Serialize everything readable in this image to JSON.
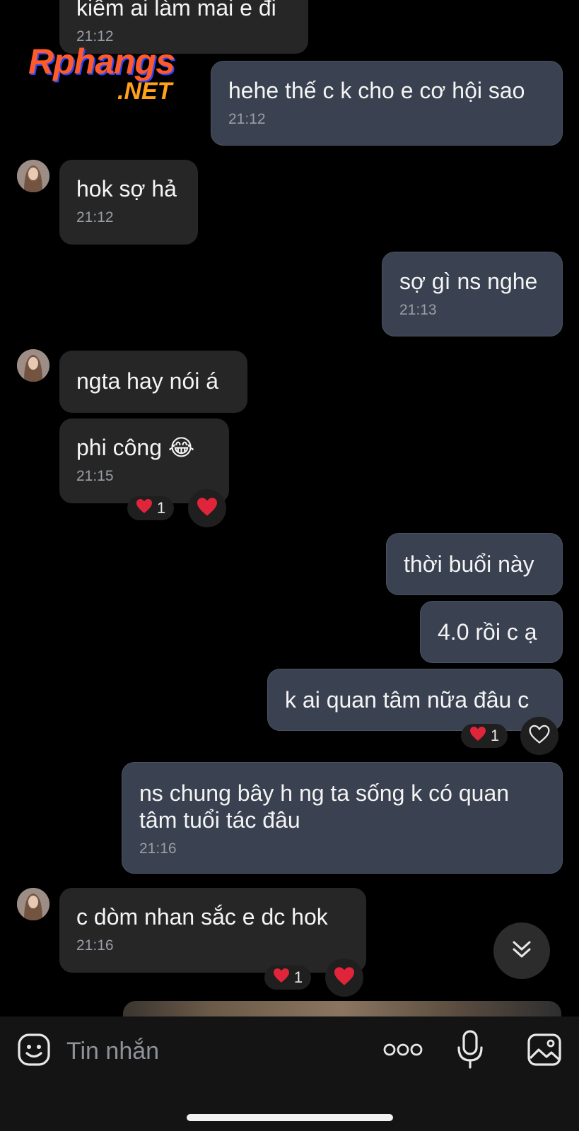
{
  "watermark": {
    "brand": "Rphangs",
    "tld": ".NET"
  },
  "messages": [
    {
      "id": "m0",
      "from": "them",
      "text": "kiếm ai làm mai e đi",
      "time": "21:12"
    },
    {
      "id": "m1",
      "from": "me",
      "text": "hehe thế c k cho e cơ hội sao",
      "time": "21:12"
    },
    {
      "id": "m2",
      "from": "them",
      "text": "hok sợ hả",
      "time": "21:12"
    },
    {
      "id": "m3",
      "from": "me",
      "text": "sợ gì ns nghe",
      "time": "21:13"
    },
    {
      "id": "m4",
      "from": "them",
      "text": "ngta hay nói á"
    },
    {
      "id": "m5",
      "from": "them",
      "text": "phi công 😂",
      "time": "21:15",
      "reaction": {
        "emoji": "❤️",
        "count": "1"
      }
    },
    {
      "id": "m6",
      "from": "me",
      "text": "thời buổi này"
    },
    {
      "id": "m7",
      "from": "me",
      "text": "4.0 rồi c ạ"
    },
    {
      "id": "m8",
      "from": "me",
      "text": "k ai quan tâm nữa đâu c",
      "reaction": {
        "emoji": "❤️",
        "count": "1"
      }
    },
    {
      "id": "m9",
      "from": "me",
      "text": "ns chung bây h ng ta sống k có quan tâm tuổi tác đâu",
      "time": "21:16"
    },
    {
      "id": "m10",
      "from": "them",
      "text": "c dòm nhan sắc e dc hok",
      "time": "21:16",
      "reaction": {
        "emoji": "❤️",
        "count": "1"
      }
    }
  ],
  "composer": {
    "placeholder": "Tin nhắn"
  },
  "icons": {
    "sticker": "smiley-sticker-icon",
    "more": "more-dots-icon",
    "mic": "microphone-icon",
    "gallery": "gallery-image-icon",
    "scroll": "chevrons-down-icon",
    "react_filled": "heart-filled-icon",
    "react_outline": "heart-outline-icon"
  },
  "colors": {
    "background": "#000000",
    "incoming_bubble": "#262626",
    "outgoing_bubble": "#3a4150",
    "heart": "#e0243a"
  }
}
